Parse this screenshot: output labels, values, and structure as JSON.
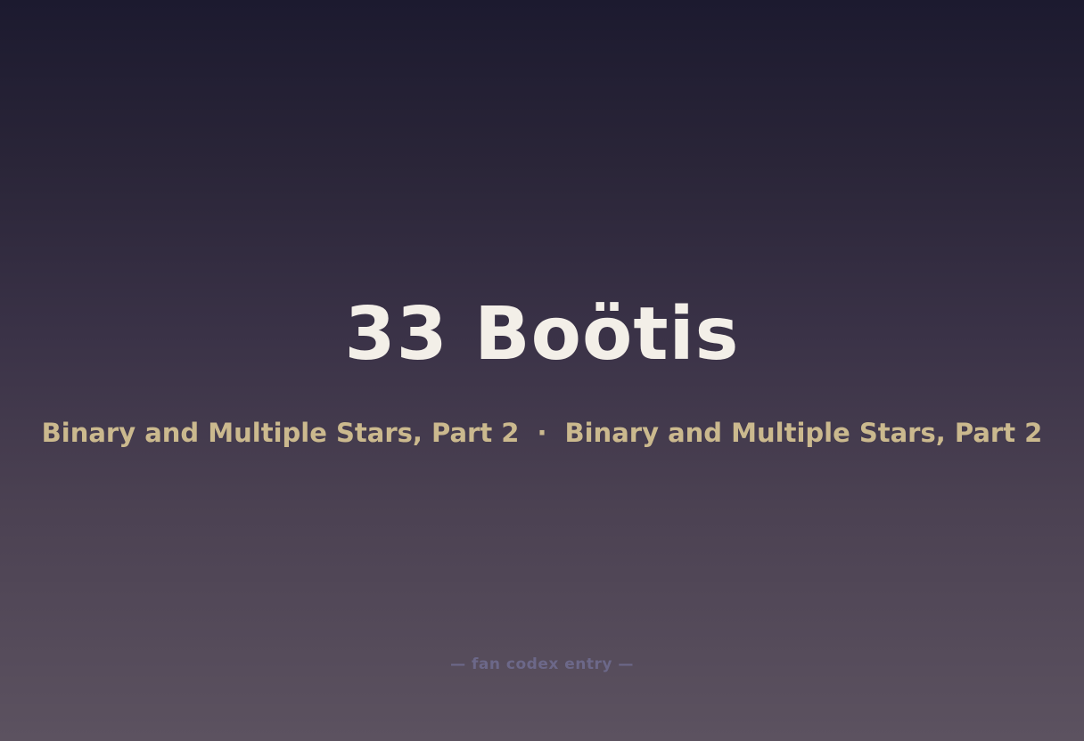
{
  "card": {
    "title": "33 Boötis",
    "subtitle_left": "Binary and Multiple Stars, Part 2",
    "subtitle_separator": "·",
    "subtitle_right": "Binary and Multiple Stars, Part 2",
    "footer": "— fan codex entry —"
  },
  "colors": {
    "background_top": "#1c1a2f",
    "background_bottom": "#5c5260",
    "title": "#f3efe8",
    "subtitle": "#cbb98e",
    "footer": "#6c6889"
  }
}
